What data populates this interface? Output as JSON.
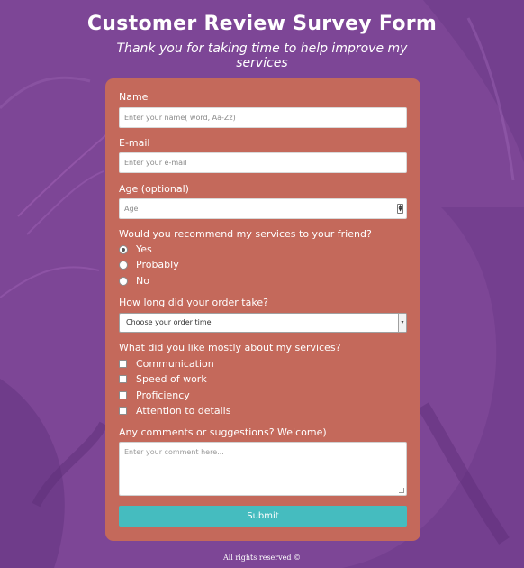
{
  "colors": {
    "background": "#7d4696",
    "card": "#c4695b",
    "submit_button": "#45bcbf"
  },
  "header": {
    "title": "Customer Review Survey Form",
    "subtitle": "Thank you for taking time to help improve my services"
  },
  "form": {
    "name": {
      "label": "Name",
      "placeholder": "Enter your name( word, Aa-Zz)"
    },
    "email": {
      "label": "E-mail",
      "placeholder": "Enter your e-mail"
    },
    "age": {
      "label": "Age (optional)",
      "placeholder": "Age"
    },
    "recommend": {
      "question": "Would you recommend my services to your friend?",
      "options": [
        "Yes",
        "Probably",
        "No"
      ],
      "selected": "Yes"
    },
    "order_time": {
      "question": "How long did your order take?",
      "selected_label": "Choose your order time"
    },
    "liked": {
      "question": "What did you like mostly about my services?",
      "options": [
        "Communication",
        "Speed of work",
        "Proficiency",
        "Attention to details"
      ]
    },
    "comments": {
      "label": "Any comments or suggestions? Welcome)",
      "placeholder": "Enter your comment here..."
    },
    "submit_label": "Submit"
  },
  "footer": {
    "text": "All rights reserved ©"
  }
}
